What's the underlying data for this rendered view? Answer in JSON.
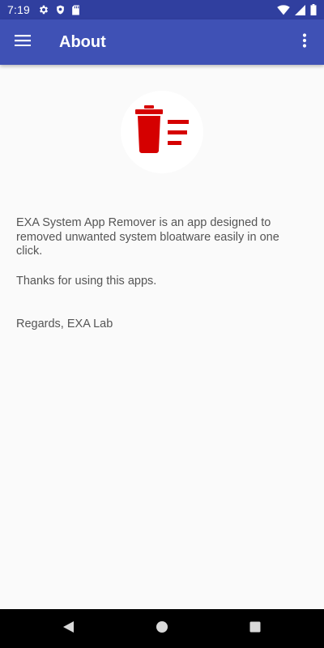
{
  "status_bar": {
    "time": "7:19",
    "icons_left": [
      "settings-icon",
      "shield-icon",
      "sd-card-icon"
    ],
    "icons_right": [
      "wifi-icon",
      "signal-icon",
      "battery-icon"
    ]
  },
  "app_bar": {
    "title": "About",
    "menu_icon": "hamburger-menu-icon",
    "overflow_icon": "more-vert-icon",
    "color": "#3f51b5",
    "status_color": "#303f9f"
  },
  "content": {
    "logo": "trash-list-icon",
    "logo_color": "#d50000",
    "description": "EXA System App Remover is an app designed to removed unwanted system bloatware easily in one click.",
    "thanks": "Thanks for using this apps.",
    "regards": "Regards, EXA Lab"
  },
  "nav_bar": {
    "back": "back-icon",
    "home": "home-icon",
    "recents": "recents-icon"
  }
}
